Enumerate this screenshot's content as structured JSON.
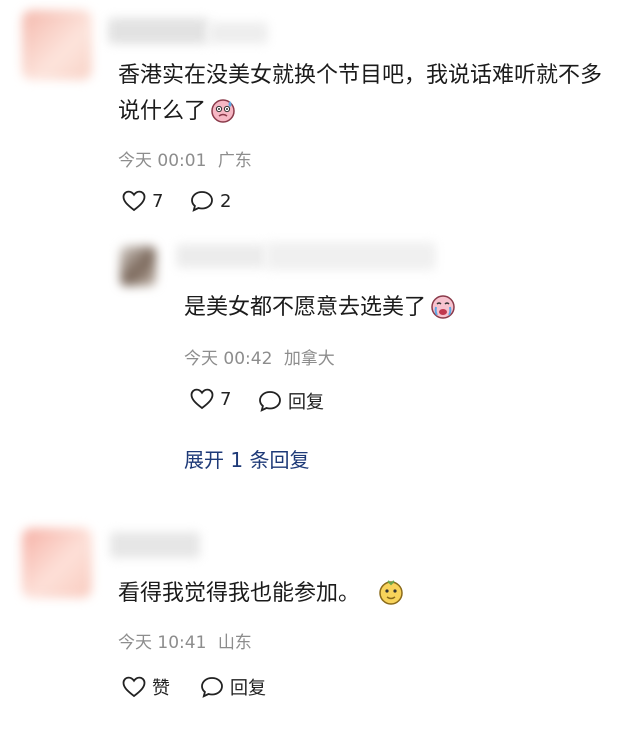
{
  "comments": [
    {
      "text": "香港实在没美女就换个节目吧，我说话难听就不多说什么了",
      "time": "今天 00:01",
      "location": "广东",
      "like_count": "7",
      "reply_count": "2",
      "emoji_icon": "sweat-face-emoji"
    },
    {
      "text": "看得我觉得我也能参加。",
      "time": "今天 10:41",
      "location": "山东",
      "like_label": "赞",
      "reply_label": "回复",
      "emoji_icon": "thinking-face-emoji"
    }
  ],
  "reply": {
    "text": "是美女都不愿意去选美了",
    "time": "今天 00:42",
    "location": "加拿大",
    "like_count": "7",
    "reply_label": "回复",
    "emoji_icon": "crying-face-emoji"
  },
  "expand_label": "展开 1 条回复",
  "colors": {
    "link": "#1e3a78",
    "meta": "#8d8d8d",
    "text": "#1b1b1b"
  }
}
